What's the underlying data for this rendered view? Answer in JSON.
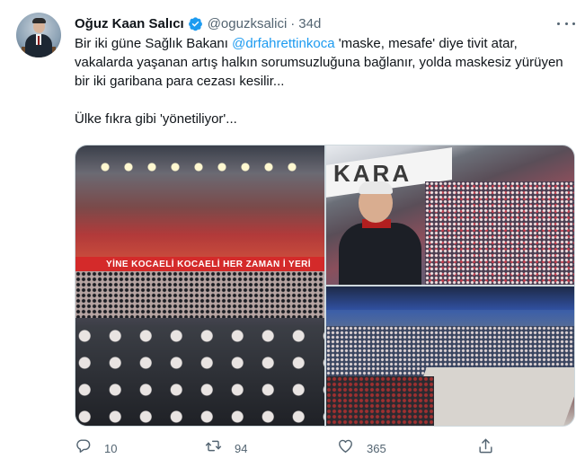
{
  "author": {
    "name": "Oğuz Kaan Salıcı",
    "handle": "@oguzksalici",
    "separator": "·",
    "time": "34d",
    "verified": true
  },
  "tweet": {
    "line1_before": "Bir iki güne Sağlık Bakanı ",
    "mention": "@drfahrettinkoca",
    "line1_after": " 'maske, mesafe' diye tivit atar, vakalarda yaşanan artış halkın sorumsuzluğuna bağlanır, yolda maskesiz yürüyen bir iki garibana para cezası kesilir...",
    "line2": "Ülke fıkra gibi 'yönetiliyor'..."
  },
  "media": {
    "banner_text": "YİNE KOCAELİ   KOCAELİ   HER ZAMAN İ YERİ",
    "sign_text": "KARA"
  },
  "actions": {
    "reply_count": "10",
    "retweet_count": "94",
    "like_count": "365"
  },
  "colors": {
    "accent": "#1d9bf0",
    "secondary_text": "#536471",
    "text": "#0f1419"
  },
  "icons": {
    "verified": "verified-badge-icon",
    "more": "more-horizontal-icon",
    "reply": "reply-icon",
    "retweet": "retweet-icon",
    "like": "heart-icon",
    "share": "share-icon"
  }
}
